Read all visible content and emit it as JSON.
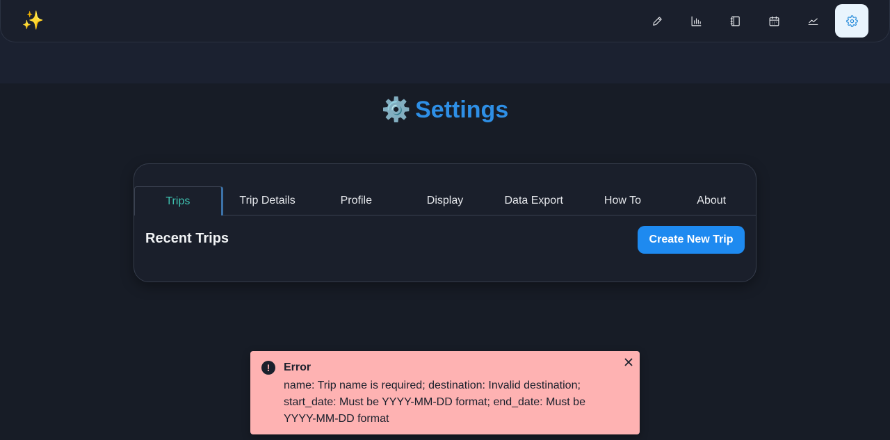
{
  "navbar": {
    "logo": "✨",
    "buttons": [
      {
        "icon": "pencil-icon"
      },
      {
        "icon": "bar-chart-icon"
      },
      {
        "icon": "notebook-icon"
      },
      {
        "icon": "calendar-icon"
      },
      {
        "icon": "line-chart-icon"
      },
      {
        "icon": "gear-icon",
        "active": true
      }
    ]
  },
  "page": {
    "title_icon": "⚙️",
    "title": "Settings"
  },
  "tabs": [
    "Trips",
    "Trip Details",
    "Profile",
    "Display",
    "Data Export",
    "How To",
    "About"
  ],
  "active_tab": "Trips",
  "trips": {
    "section_title": "Recent Trips",
    "create_button": "Create New Trip"
  },
  "toast": {
    "icon": "!",
    "title": "Error",
    "message": "name: Trip name is required; destination: Invalid destination; start_date: Must be YYYY-MM-DD format; end_date: Must be YYYY-MM-DD format"
  },
  "colors": {
    "accent": "#2e8fe6",
    "active_tab": "#3ec1b0",
    "button": "#1e8af0",
    "error_bg": "#feb2b2"
  }
}
